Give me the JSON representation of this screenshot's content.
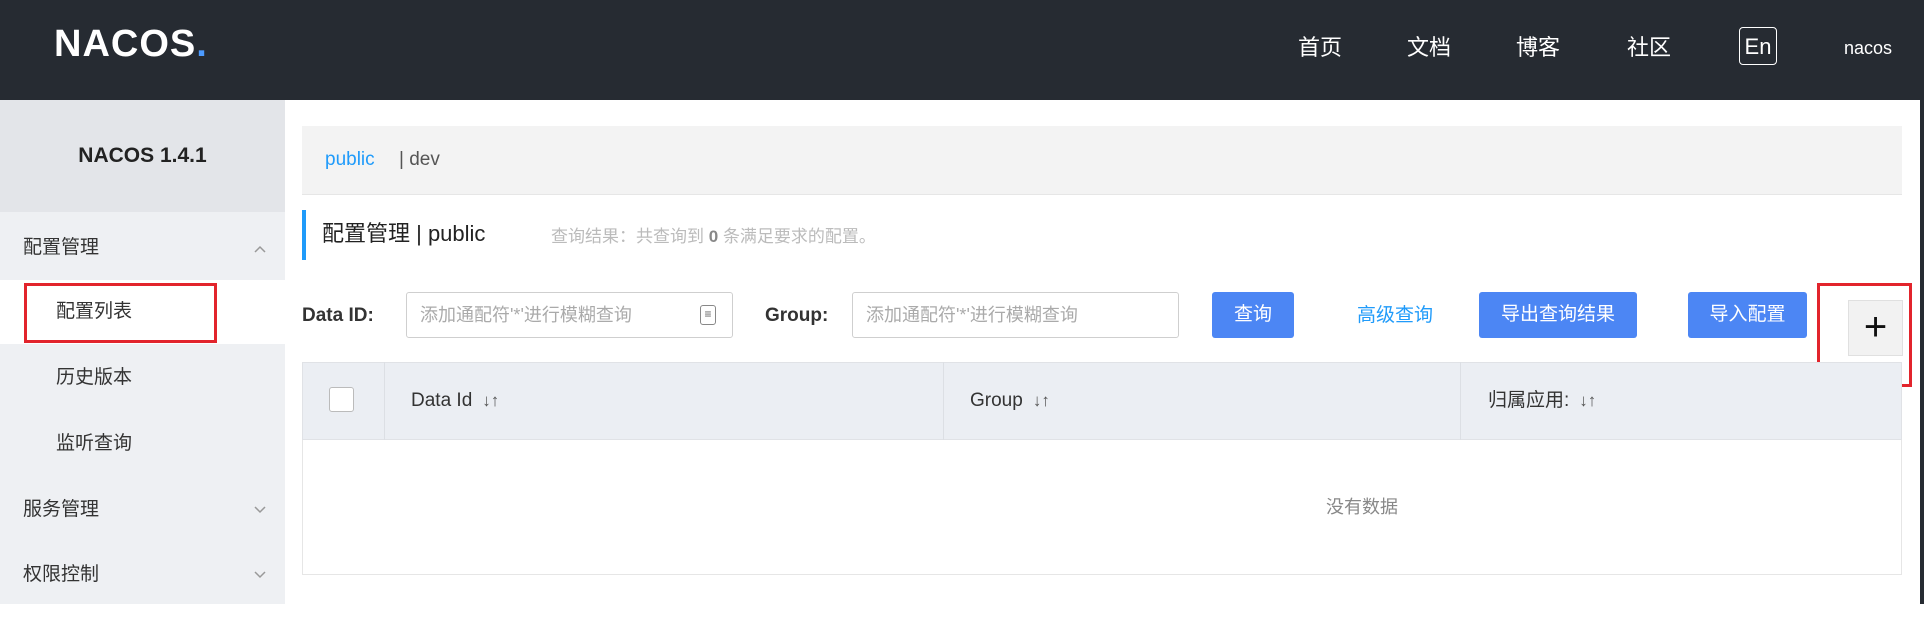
{
  "header": {
    "logo_main": "NACOS",
    "logo_dot": ".",
    "nav": [
      "首页",
      "文档",
      "博客",
      "社区"
    ],
    "lang": "En",
    "user": "nacos"
  },
  "sidebar": {
    "version": "NACOS 1.4.1",
    "groups": [
      {
        "label": "配置管理",
        "chevron": "^"
      },
      {
        "label": "服务管理",
        "chevron": "v"
      },
      {
        "label": "权限控制",
        "chevron": "v"
      }
    ],
    "config_items": [
      "配置列表",
      "历史版本",
      "监听查询"
    ]
  },
  "namespace": {
    "active": "public",
    "other": "| dev"
  },
  "page": {
    "title": "配置管理 | public",
    "hint_prefix": "查询结果：共查询到",
    "hint_count": "0",
    "hint_suffix": "条满足要求的配置。"
  },
  "search": {
    "dataid_label": "Data ID:",
    "dataid_placeholder": "添加通配符'*'进行模糊查询",
    "group_label": "Group:",
    "group_placeholder": "添加通配符'*'进行模糊查询",
    "query_button": "查询",
    "advanced_link": "高级查询",
    "export_button": "导出查询结果",
    "import_button": "导入配置",
    "add_button": "+"
  },
  "table": {
    "columns": [
      "Data Id",
      "Group",
      "归属应用:"
    ],
    "sort_icon": "↓↑",
    "empty_text": "没有数据"
  },
  "colors": {
    "header_bg": "#262b32",
    "accent": "#209bfa",
    "button": "#4c86f4",
    "highlight_box": "#e2242c"
  }
}
